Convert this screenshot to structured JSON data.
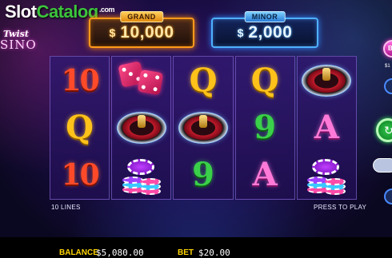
{
  "watermark": {
    "slot": "Slot",
    "catalog": "Catalog",
    "com": ".com"
  },
  "game_logo": {
    "twist": "Twist",
    "casino": "SINO"
  },
  "jackpots": {
    "grand": {
      "label": "GRAND",
      "currency": "$",
      "amount": "10,000"
    },
    "minor": {
      "label": "MINOR",
      "currency": "$",
      "amount": "2,000"
    }
  },
  "reels": [
    [
      "10",
      "Q",
      "10"
    ],
    [
      "dice",
      "roulette",
      "chips"
    ],
    [
      "Q",
      "roulette",
      "9"
    ],
    [
      "Q",
      "9",
      "A"
    ],
    [
      "roulette",
      "A",
      "chips"
    ]
  ],
  "info": {
    "lines": "10 LINES",
    "press_to_play": "PRESS TO PLAY"
  },
  "footer": {
    "balance_label": "BALANCE",
    "balance_value": "$5,080.00",
    "bet_label": "BET",
    "bet_value": "$20.00"
  },
  "side_controls": {
    "buy_label": "BU",
    "buy_price": "$1"
  },
  "colors": {
    "grand_accent": "#ff9a1a",
    "minor_accent": "#4fb0ff",
    "label_yellow": "#ffd400"
  }
}
